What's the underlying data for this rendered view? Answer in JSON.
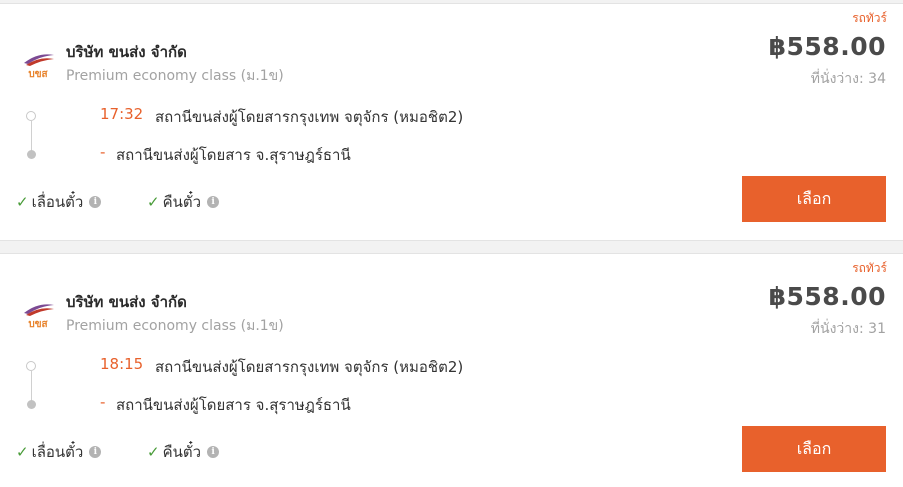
{
  "trips": [
    {
      "bus_type": "รถทัวร์",
      "company": "บริษัท ขนส่ง จำกัด",
      "class_name": "Premium economy class (ม.1ข)",
      "price": "฿558.00",
      "seats_label": "ที่นั่งว่าง:",
      "seats_value": "34",
      "departure_time": "17:32",
      "departure_station": "สถานีขนส่งผู้โดยสารกรุงเทพ จตุจักร (หมอชิต2)",
      "arrival_time": "-",
      "arrival_station": "สถานีขนส่งผู้โดยสาร จ.สุราษฎร์ธานี",
      "amenities": [
        "เลื่อนตั๋ว",
        "คืนตั๋ว"
      ],
      "select_label": "เลือก"
    },
    {
      "bus_type": "รถทัวร์",
      "company": "บริษัท ขนส่ง จำกัด",
      "class_name": "Premium economy class (ม.1ข)",
      "price": "฿558.00",
      "seats_label": "ที่นั่งว่าง:",
      "seats_value": "31",
      "departure_time": "18:15",
      "departure_station": "สถานีขนส่งผู้โดยสารกรุงเทพ จตุจักร (หมอชิต2)",
      "arrival_time": "-",
      "arrival_station": "สถานีขนส่งผู้โดยสาร จ.สุราษฎร์ธานี",
      "amenities": [
        "เลื่อนตั๋ว",
        "คืนตั๋ว"
      ],
      "select_label": "เลือก"
    }
  ],
  "logo_text": "บขส",
  "colors": {
    "accent": "#e8612c",
    "check": "#4a9c3a",
    "logo_purple": "#7b4a93",
    "logo_orange": "#e8832c"
  }
}
